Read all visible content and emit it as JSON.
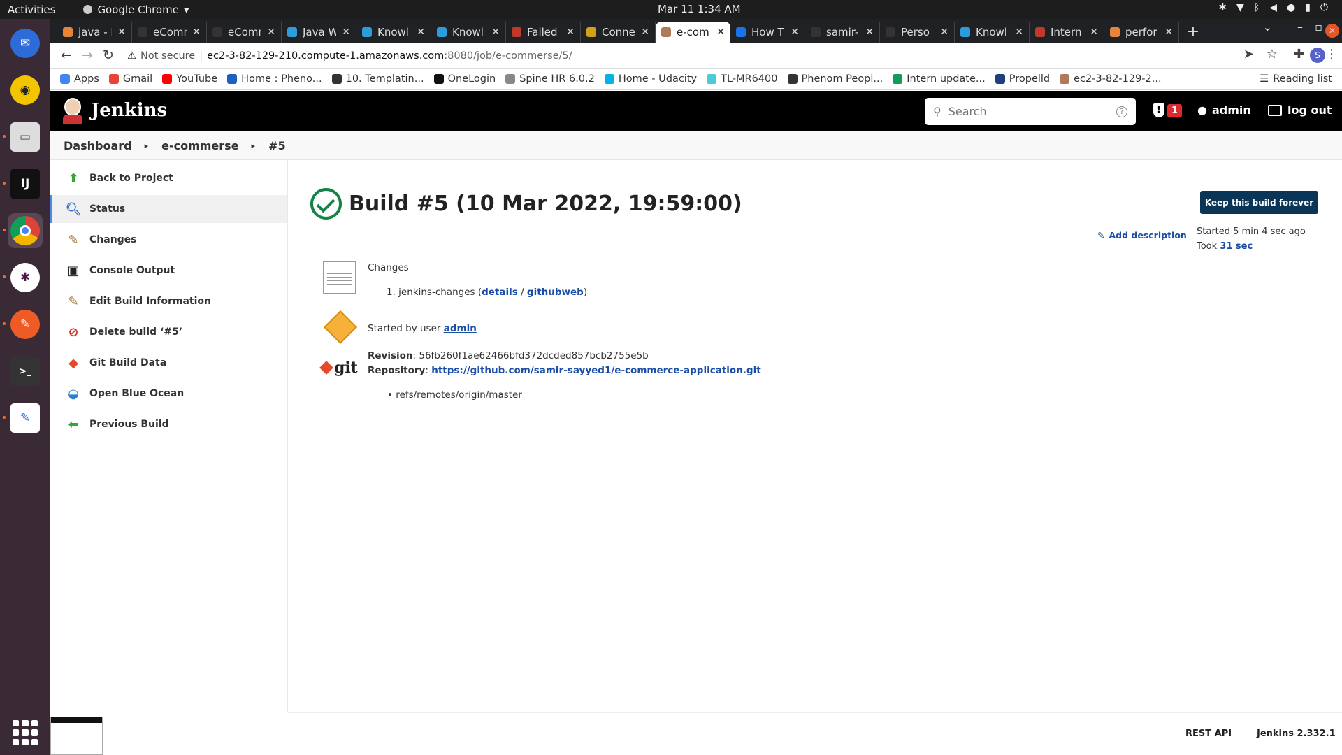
{
  "os_topbar": {
    "activities": "Activities",
    "app_name": "Google Chrome",
    "clock": "Mar 11  1:34 AM"
  },
  "tabs": [
    {
      "title": "java - H",
      "color": "#e8833a"
    },
    {
      "title": "eComm",
      "color": "#333333"
    },
    {
      "title": "eComm",
      "color": "#333333"
    },
    {
      "title": "Java W",
      "color": "#2d9cdb"
    },
    {
      "title": "Knowl",
      "color": "#2d9cdb"
    },
    {
      "title": "Knowl",
      "color": "#2d9cdb"
    },
    {
      "title": "Failed",
      "color": "#c0392b"
    },
    {
      "title": "Conne",
      "color": "#d4a017"
    },
    {
      "title": "e-com",
      "color": "#b07a5a",
      "active": true
    },
    {
      "title": "How T",
      "color": "#1a73e8"
    },
    {
      "title": "samir-",
      "color": "#333333"
    },
    {
      "title": "Perso",
      "color": "#333333"
    },
    {
      "title": "Knowl",
      "color": "#2d9cdb"
    },
    {
      "title": "Intern",
      "color": "#c0392b"
    },
    {
      "title": "perfor",
      "color": "#e8833a"
    }
  ],
  "address": {
    "security": "Not secure",
    "host": "ec2-3-82-129-210.compute-1.amazonaws.com",
    "path": ":8080/job/e-commerse/5/",
    "profile": "S"
  },
  "bookmarks": [
    {
      "label": "Apps",
      "color": "#4285f4"
    },
    {
      "label": "Gmail",
      "color": "#ea4335"
    },
    {
      "label": "YouTube",
      "color": "#ff0000"
    },
    {
      "label": "Home : Pheno...",
      "color": "#1f5fbf"
    },
    {
      "label": "10. Templatin...",
      "color": "#333333"
    },
    {
      "label": "OneLogin",
      "color": "#111111"
    },
    {
      "label": "Spine HR 6.0.2",
      "color": "#888888"
    },
    {
      "label": "Home - Udacity",
      "color": "#02b3e4"
    },
    {
      "label": "TL-MR6400",
      "color": "#4acbd6"
    },
    {
      "label": "Phenom Peopl...",
      "color": "#333333"
    },
    {
      "label": "Intern update...",
      "color": "#0f9d58"
    },
    {
      "label": "Propelld",
      "color": "#1f3f7f"
    },
    {
      "label": "ec2-3-82-129-2...",
      "color": "#b07a5a"
    }
  ],
  "reading_list": "Reading list",
  "jenkins": {
    "logo_text": "Jenkins",
    "search_placeholder": "Search",
    "alert_count": "1",
    "user": "admin",
    "logout": "log out"
  },
  "breadcrumb": [
    "Dashboard",
    "e-commerse",
    "#5"
  ],
  "side_tasks": [
    {
      "label": "Back to Project",
      "icon": "up-arrow-icon",
      "color": "#3aa33a"
    },
    {
      "label": "Status",
      "icon": "magnifier-icon",
      "color": "#3a6fcf",
      "active": true
    },
    {
      "label": "Changes",
      "icon": "notepad-icon",
      "color": "#a37b3a"
    },
    {
      "label": "Console Output",
      "icon": "terminal-icon",
      "color": "#222222"
    },
    {
      "label": "Edit Build Information",
      "icon": "notepad-edit-icon",
      "color": "#a37b3a"
    },
    {
      "label": "Delete build ‘#5’",
      "icon": "no-entry-icon",
      "color": "#d0342c"
    },
    {
      "label": "Git Build Data",
      "icon": "git-icon",
      "color": "#e24a2c"
    },
    {
      "label": "Open Blue Ocean",
      "icon": "blue-ocean-icon",
      "color": "#2a7fd4"
    },
    {
      "label": "Previous Build",
      "icon": "left-arrow-icon",
      "color": "#3aa33a"
    }
  ],
  "build": {
    "title": "Build #5 (10 Mar 2022, 19:59:00)",
    "keep_button": "Keep this build forever",
    "add_description": "Add description",
    "started_ago": "Started 5 min 4 sec ago",
    "took_label": "Took",
    "took_value": "31 sec",
    "changes_heading": "Changes",
    "change_item": "1. jenkins-changes (",
    "change_details": "details",
    "change_sep": " / ",
    "change_githubweb": "githubweb",
    "change_close": ")",
    "started_by_prefix": "Started by user",
    "started_by_user": "admin",
    "git_label": "git",
    "revision_label": "Revision",
    "revision_value": ": 56fb260f1ae62466bfd372dcded857bcb2755e5b",
    "repository_label": "Repository",
    "repository_sep": ":",
    "repository_url": "https://github.com/samir-sayyed1/e-commerce-application.git",
    "branch": "refs/remotes/origin/master"
  },
  "footer": {
    "rest_api": "REST API",
    "version": "Jenkins 2.332.1"
  }
}
